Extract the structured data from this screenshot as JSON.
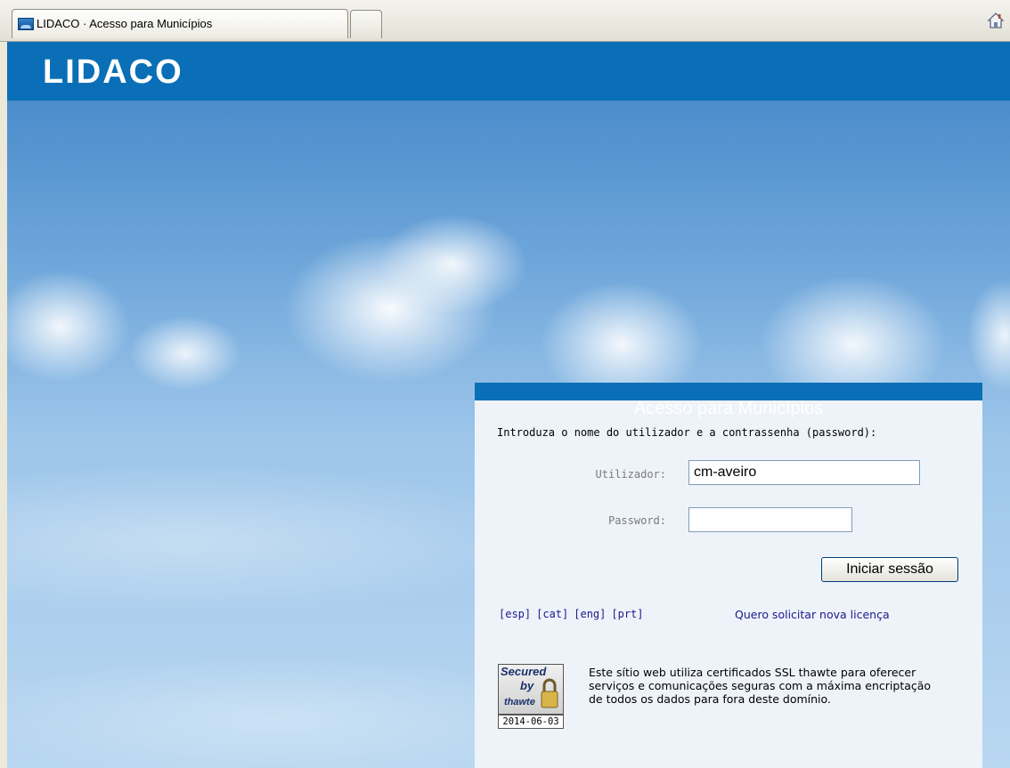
{
  "browser": {
    "tab_title": "LIDACO · Acesso para Municípios"
  },
  "brand": {
    "logo_text": "LIDACO"
  },
  "login": {
    "title": "Acesso para Municípios",
    "instructions": "Introduza o nome do utilizador e a contrassenha (password):",
    "user_label": "Utilizador:",
    "user_value": "cm-aveiro",
    "password_label": "Password:",
    "password_value": "",
    "submit_label": "Iniciar sessão",
    "languages": [
      "[esp]",
      "[cat]",
      "[eng]",
      "[prt]"
    ],
    "license_link": "Quero solicitar nova licença"
  },
  "seal": {
    "line1": "Secured",
    "line2": "by",
    "line3": "thawte",
    "date": "2014-06-03"
  },
  "ssl_text": "Este sítio web utiliza certificados SSL thawte para oferecer serviços e comunicações seguras com a máxima encriptação de todos os dados para fora deste domínio.",
  "colors": {
    "brand_blue": "#0a6fb6",
    "link": "#1a1a8c"
  }
}
